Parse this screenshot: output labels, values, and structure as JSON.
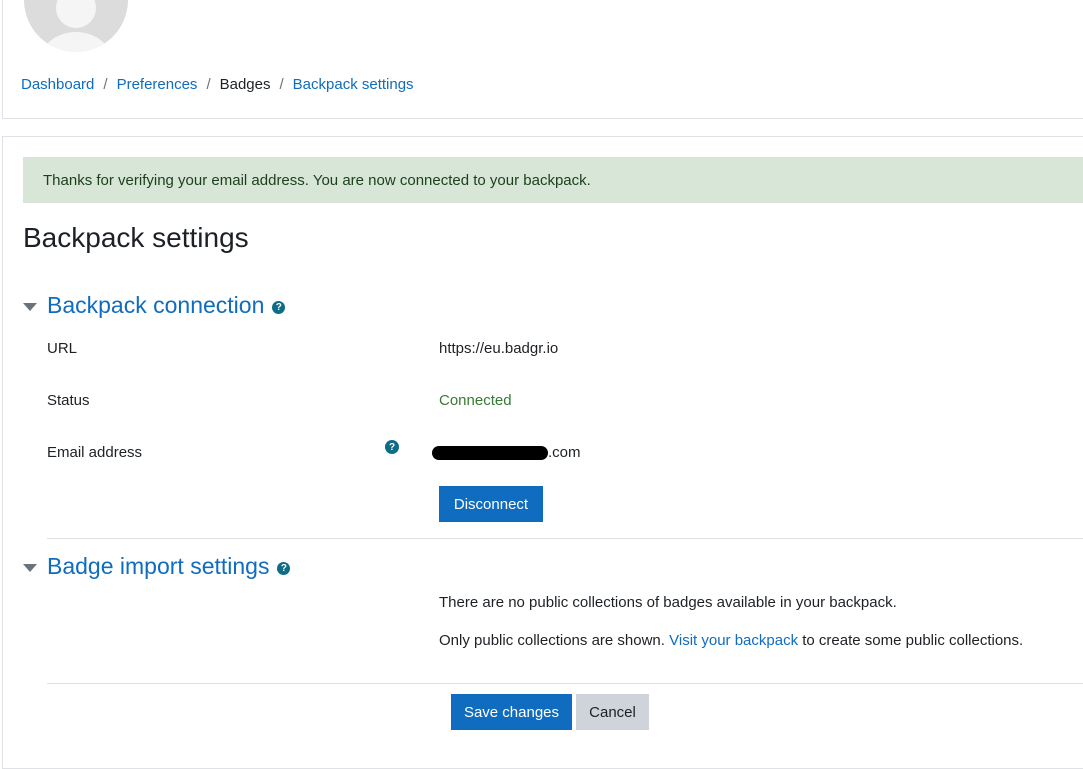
{
  "breadcrumb": {
    "items": [
      {
        "label": "Dashboard",
        "link": true
      },
      {
        "label": "Preferences",
        "link": true
      },
      {
        "label": "Badges",
        "link": false
      },
      {
        "label": "Backpack settings",
        "link": true
      }
    ],
    "separator": "/"
  },
  "alert": {
    "message": "Thanks for verifying your email address. You are now connected to your backpack."
  },
  "page": {
    "title": "Backpack settings"
  },
  "backpack_connection": {
    "title": "Backpack connection",
    "url_label": "URL",
    "url_value": "https://eu.badgr.io",
    "status_label": "Status",
    "status_value": "Connected",
    "email_label": "Email address",
    "email_suffix": ".com",
    "disconnect_label": "Disconnect"
  },
  "badge_import": {
    "title": "Badge import settings",
    "no_collections_text": "There are no public collections of badges available in your backpack.",
    "only_public_text": "Only public collections are shown.",
    "visit_link_text": "Visit your backpack",
    "after_link_text": "to create some public collections."
  },
  "actions": {
    "save_label": "Save changes",
    "cancel_label": "Cancel"
  },
  "colors": {
    "accent": "#0f6cbf",
    "success": "#357a32",
    "alert_bg": "#d7e6d7"
  },
  "icons": {
    "help": "question-circle-icon",
    "collapse": "caret-down-icon"
  }
}
